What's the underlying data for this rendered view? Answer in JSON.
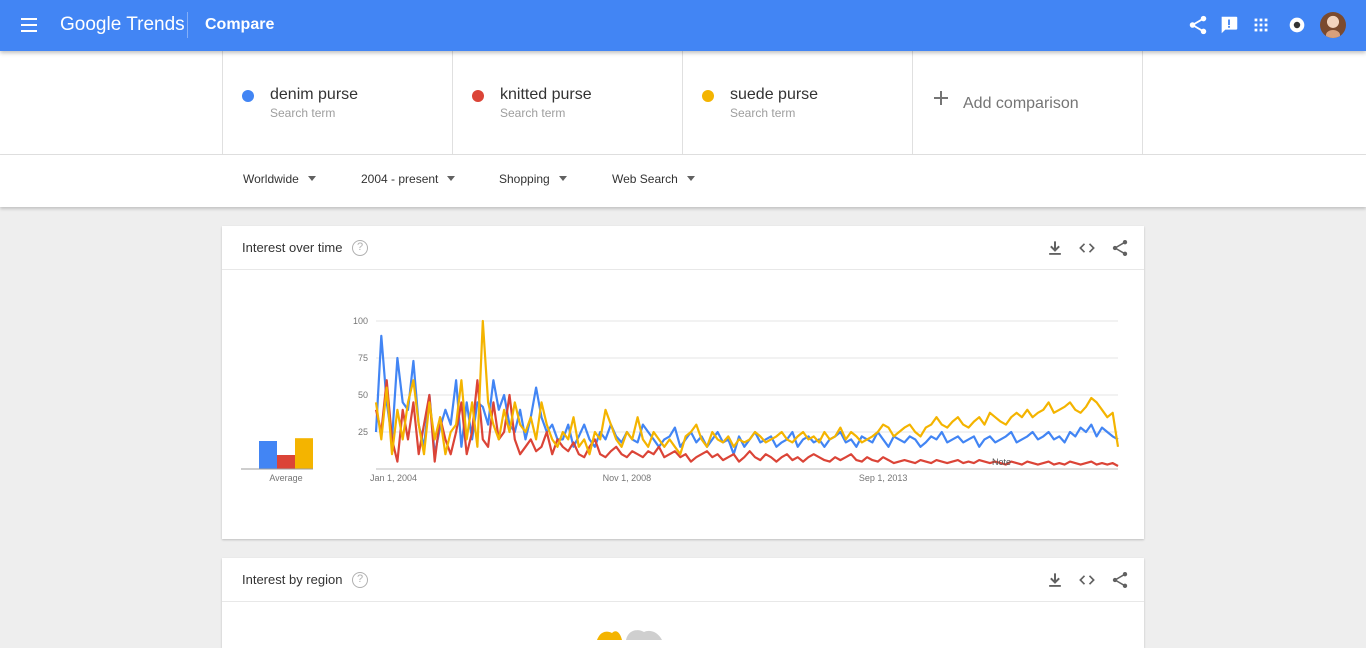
{
  "app": {
    "logo_brand": "Google",
    "logo_product": "Trends",
    "page_name": "Compare"
  },
  "topbar_icons": [
    "share-icon",
    "feedback-icon",
    "apps-grid-icon",
    "notifications-icon"
  ],
  "terms": [
    {
      "name": "denim purse",
      "type": "Search term",
      "color": "#4285f4"
    },
    {
      "name": "knitted purse",
      "type": "Search term",
      "color": "#db4437"
    },
    {
      "name": "suede purse",
      "type": "Search term",
      "color": "#f4b400"
    }
  ],
  "add_comparison": "Add comparison",
  "filters": {
    "region": "Worldwide",
    "time": "2004 - present",
    "category": "Shopping",
    "property": "Web Search"
  },
  "interest_over_time": {
    "title": "Interest over time",
    "help": "?",
    "average_label": "Average",
    "note_label": "Note"
  },
  "interest_by_region": {
    "title": "Interest by region",
    "help": "?"
  },
  "chart_data": {
    "type": "line",
    "x_tick_labels": [
      "Jan 1, 2004",
      "Nov 1, 2008",
      "Sep 1, 2013"
    ],
    "y_ticks": [
      25,
      50,
      75,
      100
    ],
    "ylim": [
      0,
      100
    ],
    "grid": true,
    "averages": [
      {
        "term": "denim purse",
        "value": 20,
        "color": "#4285f4"
      },
      {
        "term": "knitted purse",
        "value": 10,
        "color": "#db4437"
      },
      {
        "term": "suede purse",
        "value": 22,
        "color": "#f4b400"
      }
    ],
    "series": [
      {
        "name": "denim purse",
        "color": "#4285f4",
        "values": [
          25,
          90,
          45,
          20,
          75,
          45,
          40,
          73,
          30,
          15,
          50,
          10,
          28,
          40,
          30,
          60,
          15,
          45,
          20,
          45,
          42,
          30,
          60,
          40,
          50,
          30,
          25,
          40,
          20,
          35,
          55,
          35,
          25,
          30,
          20,
          20,
          30,
          15,
          22,
          30,
          20,
          15,
          25,
          20,
          30,
          22,
          18,
          25,
          20,
          18,
          30,
          25,
          20,
          15,
          20,
          22,
          28,
          15,
          20,
          25,
          18,
          22,
          15,
          20,
          25,
          18,
          20,
          10,
          22,
          15,
          20,
          25,
          18,
          20,
          22,
          15,
          18,
          20,
          25,
          15,
          20,
          22,
          18,
          20,
          15,
          20,
          22,
          25,
          18,
          20,
          15,
          22,
          20,
          18,
          25,
          20,
          15,
          22,
          20,
          18,
          22,
          20,
          15,
          18,
          22,
          20,
          25,
          18,
          20,
          22,
          18,
          20,
          22,
          15,
          20,
          22,
          18,
          20,
          22,
          25,
          18,
          20,
          22,
          25,
          20,
          22,
          25,
          20,
          22,
          18,
          25,
          22,
          28,
          25,
          30,
          22,
          28,
          25,
          22,
          20
        ]
      },
      {
        "name": "knitted purse",
        "color": "#db4437",
        "values": [
          40,
          25,
          60,
          20,
          5,
          40,
          20,
          45,
          10,
          30,
          50,
          5,
          35,
          20,
          10,
          25,
          45,
          10,
          25,
          60,
          20,
          15,
          45,
          20,
          25,
          50,
          20,
          10,
          15,
          20,
          12,
          15,
          25,
          10,
          20,
          15,
          12,
          18,
          10,
          8,
          15,
          20,
          10,
          8,
          12,
          15,
          10,
          8,
          12,
          10,
          8,
          12,
          10,
          15,
          8,
          10,
          12,
          8,
          10,
          5,
          8,
          10,
          12,
          8,
          10,
          6,
          8,
          10,
          5,
          8,
          12,
          8,
          6,
          10,
          8,
          5,
          8,
          10,
          6,
          8,
          5,
          8,
          10,
          8,
          6,
          5,
          8,
          6,
          8,
          10,
          6,
          5,
          8,
          6,
          5,
          8,
          6,
          4,
          5,
          6,
          5,
          4,
          6,
          5,
          4,
          6,
          5,
          4,
          5,
          6,
          4,
          5,
          4,
          6,
          5,
          4,
          5,
          4,
          3,
          5,
          4,
          3,
          5,
          4,
          3,
          4,
          5,
          3,
          4,
          3,
          5,
          4,
          3,
          4,
          5,
          3,
          4,
          3,
          4,
          2
        ]
      },
      {
        "name": "suede purse",
        "color": "#f4b400",
        "values": [
          45,
          20,
          55,
          10,
          40,
          20,
          45,
          60,
          30,
          10,
          45,
          20,
          35,
          10,
          25,
          30,
          60,
          20,
          45,
          15,
          100,
          45,
          30,
          20,
          40,
          25,
          45,
          30,
          25,
          35,
          20,
          45,
          30,
          20,
          15,
          25,
          20,
          35,
          15,
          20,
          10,
          25,
          20,
          40,
          30,
          20,
          15,
          25,
          20,
          35,
          20,
          15,
          25,
          20,
          15,
          20,
          15,
          10,
          22,
          25,
          30,
          20,
          15,
          25,
          20,
          18,
          22,
          15,
          20,
          18,
          20,
          25,
          22,
          18,
          20,
          22,
          25,
          20,
          18,
          22,
          25,
          20,
          22,
          18,
          25,
          20,
          22,
          28,
          20,
          25,
          22,
          18,
          20,
          22,
          25,
          30,
          28,
          22,
          25,
          28,
          30,
          25,
          22,
          28,
          30,
          35,
          30,
          28,
          32,
          35,
          30,
          28,
          32,
          35,
          30,
          38,
          35,
          32,
          30,
          35,
          38,
          35,
          40,
          35,
          38,
          40,
          45,
          38,
          40,
          42,
          45,
          40,
          38,
          42,
          48,
          45,
          40,
          35,
          38,
          15
        ]
      }
    ]
  }
}
